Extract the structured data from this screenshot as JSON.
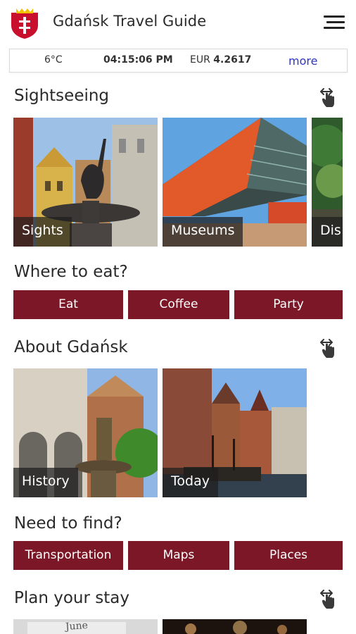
{
  "app": {
    "title": "Gdańsk Travel Guide"
  },
  "info": {
    "temperature": "6°C",
    "time": "04:15:06 PM",
    "currency_code": "EUR",
    "currency_rate": "4.2617",
    "more_link": "more"
  },
  "sections": {
    "sightseeing": {
      "title": "Sightseeing",
      "cards": [
        "Sights",
        "Museums",
        "Dis"
      ]
    },
    "eat": {
      "title": "Where to eat?",
      "buttons": [
        "Eat",
        "Coffee",
        "Party"
      ]
    },
    "about": {
      "title": "About Gdańsk",
      "cards": [
        "History",
        "Today"
      ]
    },
    "find": {
      "title": "Need to find?",
      "buttons": [
        "Transportation",
        "Maps",
        "Places"
      ]
    },
    "plan": {
      "title": "Plan your stay",
      "cards": [
        "June"
      ]
    }
  },
  "icons": {
    "crest": "gdansk-coat-of-arms",
    "menu": "hamburger-menu-icon",
    "swipe": "swipe-hand-icon"
  },
  "colors": {
    "accent": "#7b1726",
    "link": "#2c35c9",
    "crest_red": "#c8102e",
    "crest_gold": "#f2c200"
  }
}
